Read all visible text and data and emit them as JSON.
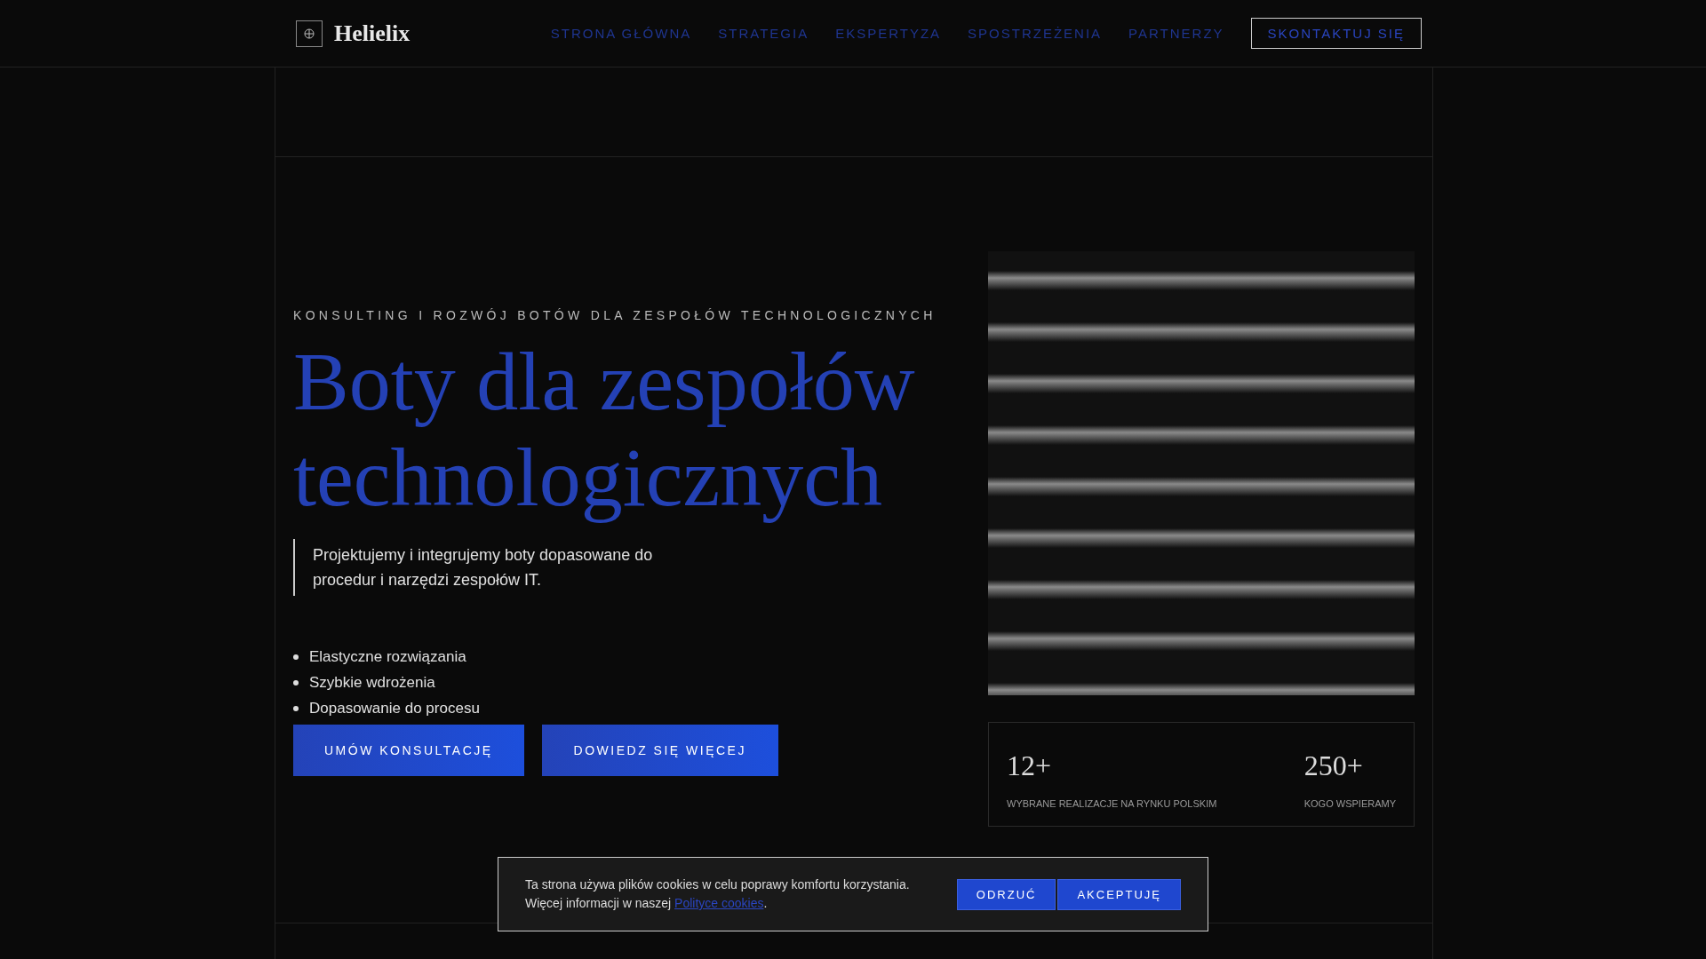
{
  "header": {
    "logo": "Helielix",
    "nav": [
      {
        "label": "STRONA GŁÓWNA"
      },
      {
        "label": "STRATEGIA"
      },
      {
        "label": "EKSPERTYZA"
      },
      {
        "label": "SPOSTRZEŻENIA"
      },
      {
        "label": "PARTNERZY"
      }
    ],
    "cta": "SKONTAKTUJ SIĘ"
  },
  "hero": {
    "eyebrow": "KONSULTING I ROZWÓJ BOTÓW DLA ZESPOŁÓW TECHNOLOGICZNYCH",
    "title": "Boty dla zespołów technologicznych",
    "lead": "Projektujemy i integrujemy boty dopasowane do procedur i narzędzi zespołów IT.",
    "bullets": [
      "Elastyczne rozwiązania",
      "Szybkie wdrożenia",
      "Dopasowanie do procesu"
    ],
    "buttons": [
      "UMÓW KONSULTACJĘ",
      "DOWIEDZ SIĘ WIĘCEJ"
    ]
  },
  "stats": [
    {
      "value": "12+",
      "label": "WYBRANE REALIZACJE NA RYNKU POLSKIM"
    },
    {
      "value": "250+",
      "label": "KOGO WSPIERAMY"
    }
  ],
  "cookie_banner": {
    "text": "Ta strona używa plików cookies w celu poprawy komfortu korzystania. Więcej informacji w naszej",
    "link": "Polityce cookies",
    "after": ".",
    "buttons": [
      "ODRZUĆ",
      "AKCEPTUJĘ"
    ]
  }
}
